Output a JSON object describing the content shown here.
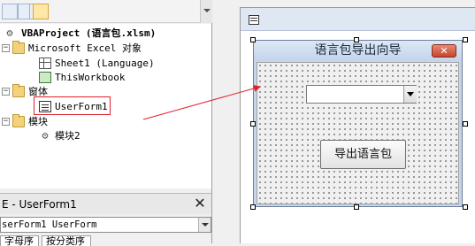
{
  "project_explorer": {
    "tree": {
      "project": "VBAProject (语言包.xlsm)",
      "excel_objects_folder": "Microsoft Excel 对象",
      "sheet1": "Sheet1 (Language)",
      "this_workbook": "ThisWorkbook",
      "forms_folder": "窗体",
      "userform1": "UserForm1",
      "modules_folder": "模块",
      "module2": "模块2"
    }
  },
  "properties_window": {
    "title": "E - UserForm1",
    "object_selector": "serForm1 UserForm",
    "tabs": [
      "字母序",
      "按分类序"
    ]
  },
  "userform": {
    "caption": "语言包导出向导",
    "close_glyph": "✕",
    "combo_value": "",
    "button_label": "导出语言包"
  },
  "colors": {
    "highlight_box": "#e0202a",
    "arrow": "#e0202a",
    "form_titlebar": "#c6d6ea",
    "close_button": "#c6452c"
  },
  "icons": [
    "vbaproject-icon",
    "folder-icon",
    "worksheet-icon",
    "workbook-icon",
    "userform-icon",
    "module-icon",
    "close-icon",
    "dropdown-arrow-icon"
  ]
}
